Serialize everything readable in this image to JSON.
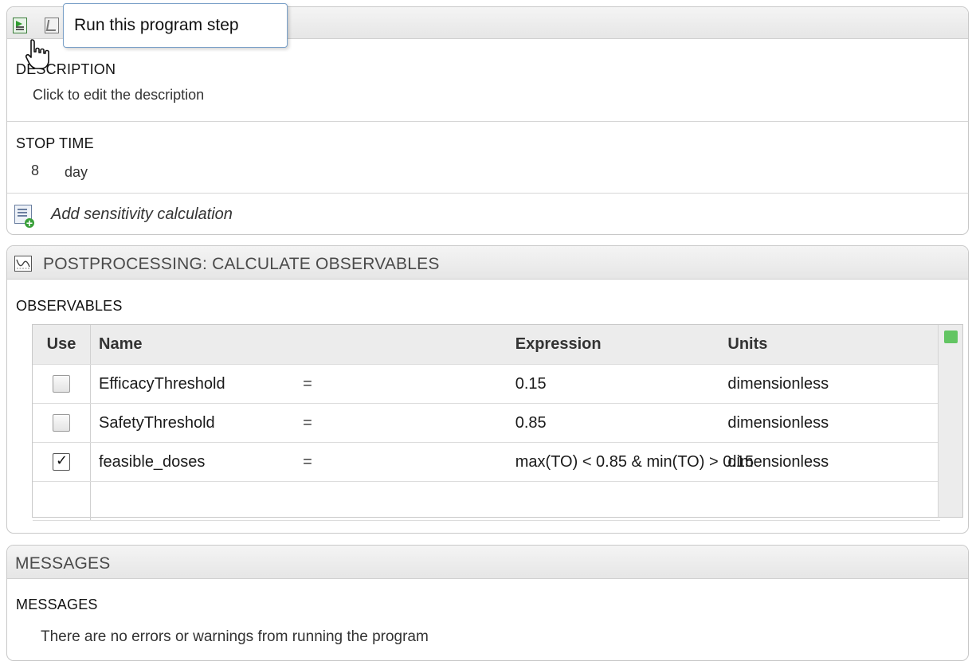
{
  "tooltip": {
    "text": "Run this program step"
  },
  "simulation": {
    "description_label": "DESCRIPTION",
    "description_text": "Click to edit the description",
    "stop_time_label": "STOP TIME",
    "stop_time_value": "8",
    "stop_time_units": "day",
    "add_sensitivity": "Add sensitivity calculation"
  },
  "postprocessing": {
    "title": "POSTPROCESSING: CALCULATE OBSERVABLES",
    "observables_label": "OBSERVABLES",
    "columns": {
      "use": "Use",
      "name": "Name",
      "expression": "Expression",
      "units": "Units"
    },
    "rows": [
      {
        "use": false,
        "name": "EfficacyThreshold",
        "eq": "=",
        "expression": "0.15",
        "units": "dimensionless"
      },
      {
        "use": false,
        "name": "SafetyThreshold",
        "eq": "=",
        "expression": "0.85",
        "units": "dimensionless"
      },
      {
        "use": true,
        "name": "feasible_doses",
        "eq": "=",
        "expression": "max(TO) < 0.85 & min(TO) > 0.15",
        "units": "dimensionless"
      }
    ],
    "status_color": "#63c563"
  },
  "messages": {
    "title": "MESSAGES",
    "label": "MESSAGES",
    "text": "There are no errors or warnings from running the program"
  },
  "icons": {
    "run": "run-step-icon",
    "other": "step-icon",
    "sensitivity": "add-sensitivity-icon",
    "postprocessing": "plot-icon"
  }
}
